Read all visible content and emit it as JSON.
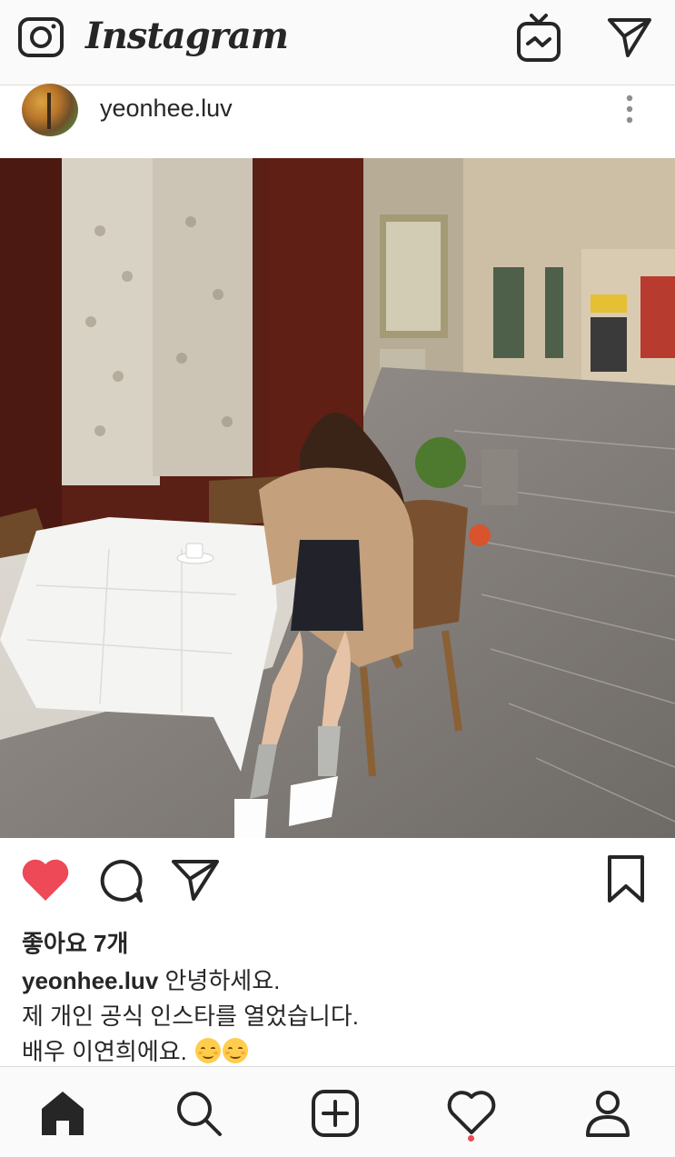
{
  "topbar": {
    "logo_text": "Instagram",
    "icons": [
      "camera-icon",
      "igtv-icon",
      "direct-message-icon"
    ]
  },
  "post": {
    "username": "yeonhee.luv",
    "menu_icon": "more-vertical-icon",
    "photo_icon": "post-photo",
    "actions": {
      "liked": true,
      "like_color": "#ed4956",
      "icons": [
        "heart-filled-icon",
        "comment-icon",
        "share-icon",
        "bookmark-icon"
      ]
    },
    "likes_text": "좋아요 7개",
    "caption": {
      "username": "yeonhee.luv",
      "line1": "안녕하세요.",
      "line2": "제 개인 공식 인스타를 열었습니다.",
      "line3": "배우 이연희에요.",
      "emoji": [
        "smiling-face-icon",
        "smiling-face-icon"
      ]
    }
  },
  "bottomnav": {
    "items": [
      "home-icon",
      "search-icon",
      "add-post-icon",
      "activity-heart-icon",
      "profile-icon"
    ],
    "active": "home-icon",
    "activity_has_notification": true,
    "notification_color": "#ed4956"
  }
}
